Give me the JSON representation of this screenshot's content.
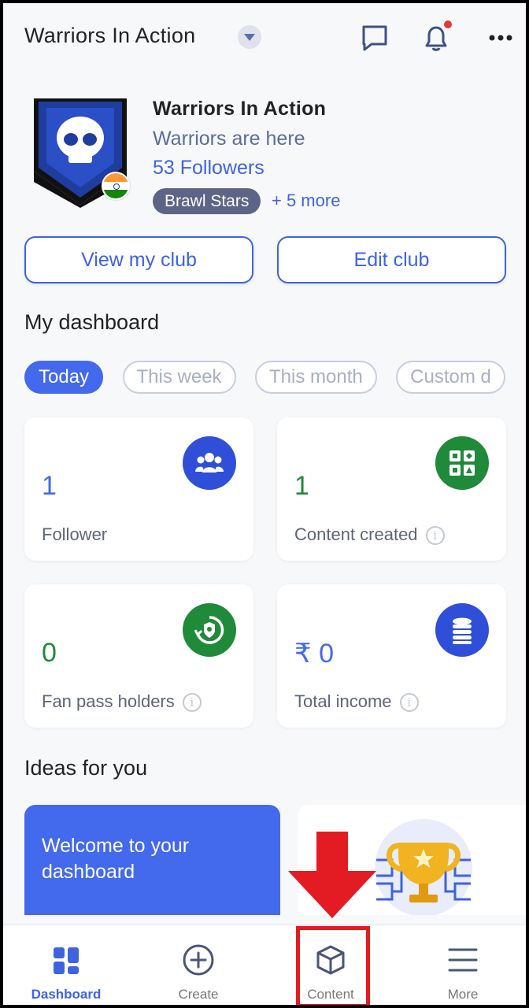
{
  "header": {
    "club_title": "Warriors  In  Action",
    "icons": [
      "chevron-down-icon",
      "chat-icon",
      "bell-icon",
      "more-dots-icon"
    ],
    "has_notification": true
  },
  "profile": {
    "name": "Warriors  In  Action",
    "tagline": "Warriors are here",
    "followers": "53 Followers",
    "game_chip": "Brawl Stars",
    "more_games": "+ 5 more"
  },
  "actions": {
    "view_club": "View my club",
    "edit_club": "Edit club"
  },
  "dashboard": {
    "title": "My dashboard",
    "filters": [
      {
        "label": "Today",
        "active": true
      },
      {
        "label": "This week",
        "active": false
      },
      {
        "label": "This month",
        "active": false
      },
      {
        "label": "Custom d",
        "active": false
      }
    ],
    "stats": [
      {
        "value": "1",
        "label": "Follower",
        "icon": "people-icon",
        "color": "#2f4fd8"
      },
      {
        "value": "1",
        "label": "Content created",
        "icon": "qr-content-icon",
        "color": "#1f8a3a"
      },
      {
        "value": "0",
        "label": "Fan pass holders",
        "icon": "pass-refresh-icon",
        "color": "#1f8a3a"
      },
      {
        "value": "₹ 0",
        "label": "Total income",
        "icon": "coins-icon",
        "color": "#2f4fd8"
      }
    ]
  },
  "ideas": {
    "title": "Ideas for you",
    "card1_text": "Welcome to your dashboard"
  },
  "bottom_nav": [
    {
      "label": "Dashboard",
      "icon": "dashboard-icon",
      "active": true
    },
    {
      "label": "Create",
      "icon": "plus-circle-icon",
      "active": false
    },
    {
      "label": "Content",
      "icon": "cube-icon",
      "active": false
    },
    {
      "label": "More",
      "icon": "hamburger-icon",
      "active": false
    }
  ],
  "colors": {
    "accent": "#3e63e0",
    "green": "#1f8a3a",
    "annotation_red": "#e31b23"
  }
}
